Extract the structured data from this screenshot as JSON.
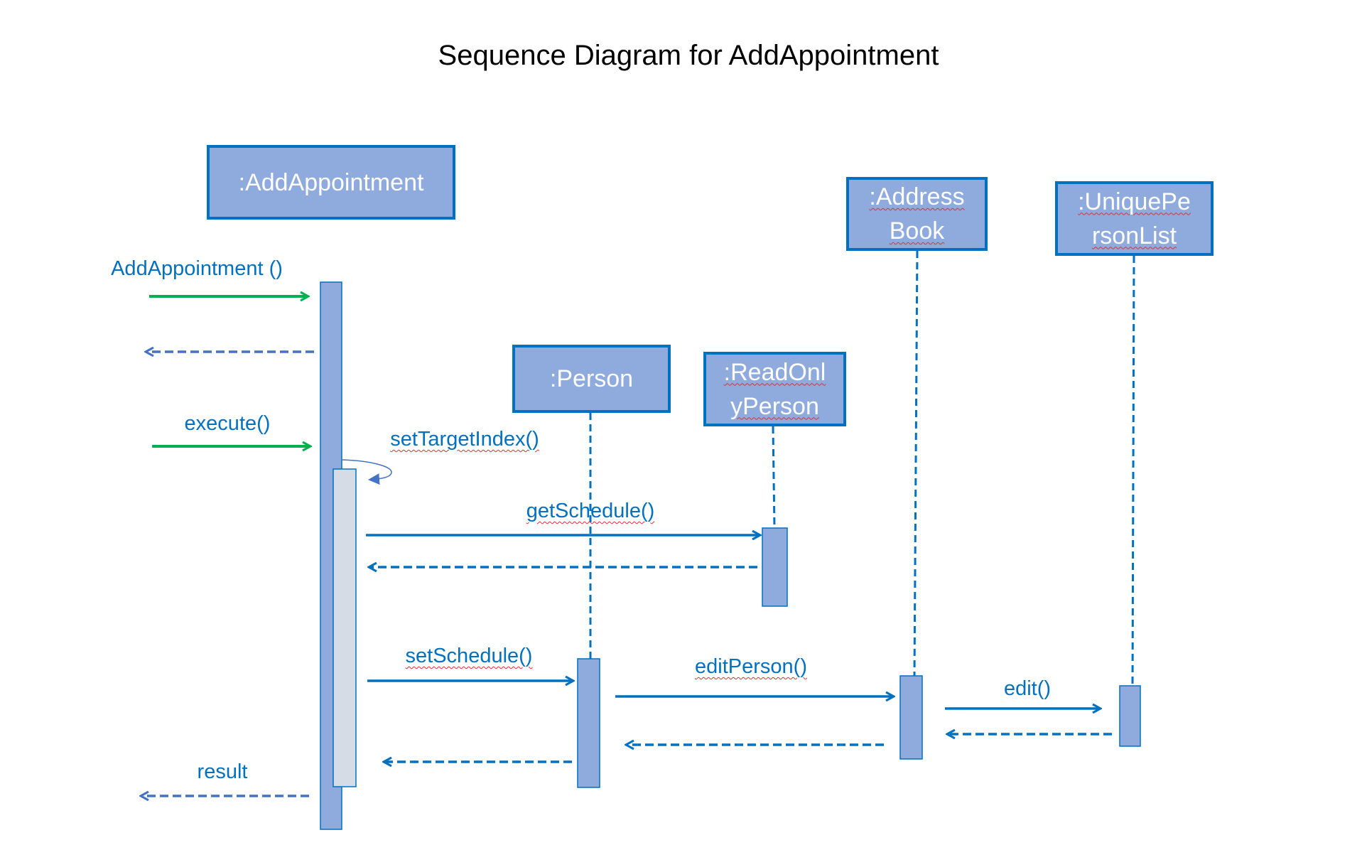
{
  "title": "Sequence Diagram for AddAppointment",
  "participants": {
    "add_appointment": {
      "line1": ":AddAppointment"
    },
    "person": {
      "line1": ":Person"
    },
    "read_only_person": {
      "line1": ":ReadOnl",
      "line2": "yPerson"
    },
    "address_book": {
      "line1": ":Address",
      "line2": "Book"
    },
    "unique_person_list": {
      "line1": ":UniquePe",
      "line2": "rsonList"
    }
  },
  "messages": {
    "add_appointment_call": "AddAppointment ()",
    "execute_call": "execute()",
    "set_target_index": "setTargetIndex()",
    "get_schedule": "getSchedule()",
    "set_schedule": "setSchedule()",
    "edit_person": "editPerson()",
    "edit": "edit()",
    "result": "result"
  },
  "colors": {
    "box_fill": "#8faadc",
    "box_border": "#0070c0",
    "message": "#0070c0",
    "entry_call": "#00b050",
    "external_return": "#4472c4",
    "inner_activation": "#d6dce5"
  }
}
